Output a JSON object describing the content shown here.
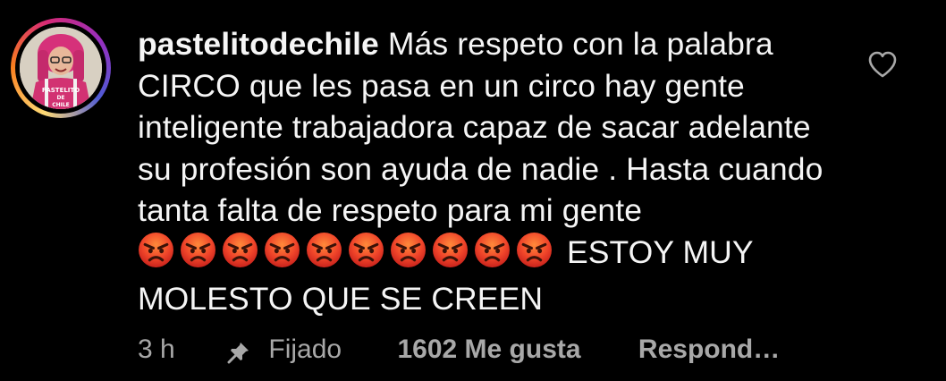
{
  "comment": {
    "username": "pastelitodechile",
    "text_before_emojis": " Más respeto con la palabra CIRCO que les pasa en un circo hay gente inteligente trabajadora capaz de sacar adelante su profesión son ayuda de nadie . Hasta cuando tanta falta de respeto para mi gente",
    "emojis": [
      "angry-face",
      "angry-face",
      "angry-face",
      "angry-face",
      "angry-face",
      "angry-face",
      "angry-face",
      "angry-face",
      "angry-face",
      "angry-face"
    ],
    "text_after_emojis": "ESTOY MUY MOLESTO QUE SE CREEN",
    "avatar_shirt_text": "PASTELITO DE CHILE"
  },
  "meta": {
    "time": "3 h",
    "pinned_label": "Fijado",
    "likes": "1602 Me gusta",
    "reply": "Respond…"
  },
  "icons": {
    "like": "heart-outline-icon",
    "pin": "pin-icon"
  },
  "colors": {
    "background": "#000000",
    "text": "#f5f5f5",
    "meta_text": "#a8a8a8"
  }
}
